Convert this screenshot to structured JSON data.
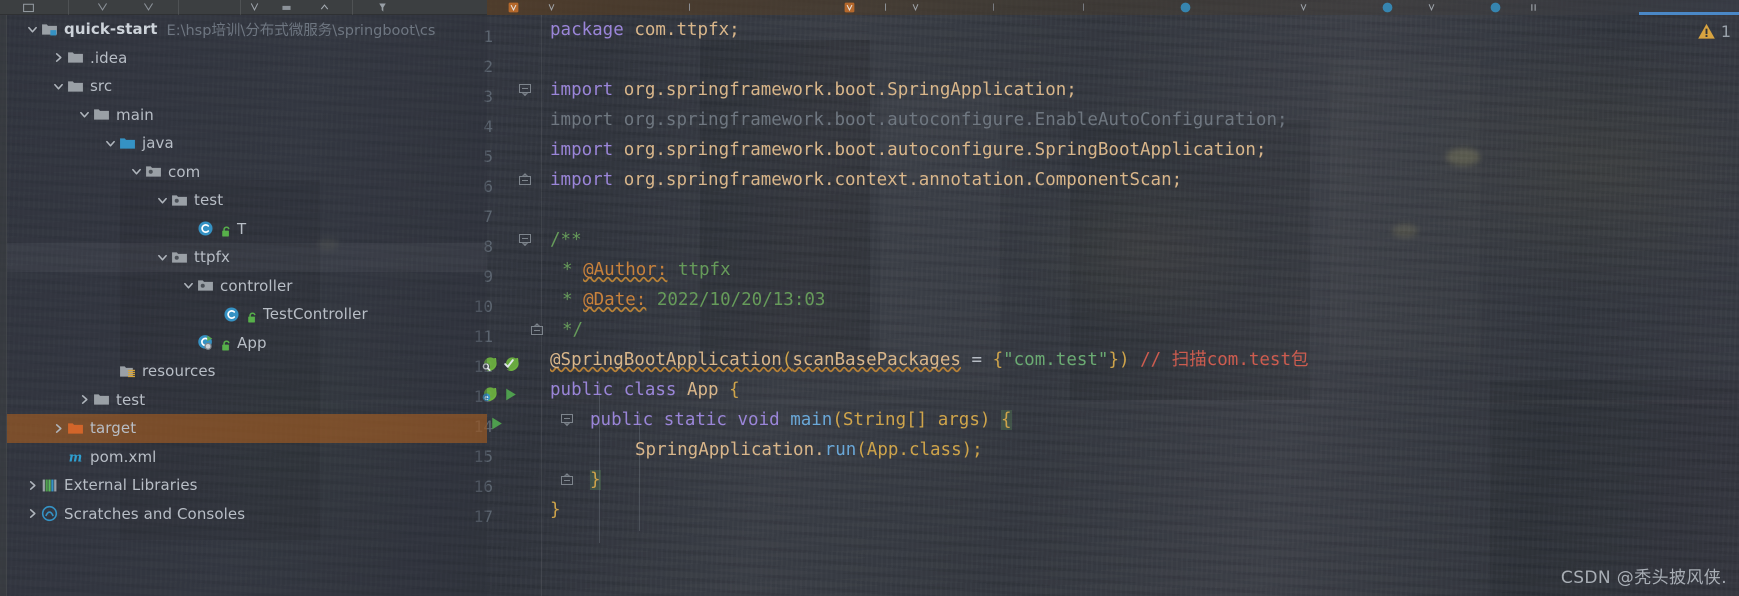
{
  "window": {
    "watermark": "CSDN @秃头披风侠."
  },
  "editor_status": {
    "warning_icon": "warning-triangle-icon",
    "warning_count": "1"
  },
  "project_tree": {
    "root": {
      "label": "quick-start",
      "path": "E:\\hsp培训\\分布式微服务\\springboot\\cs",
      "icon": "module-folder-icon",
      "arrow": "chevron-down-icon"
    },
    "items": [
      {
        "label": ".idea",
        "icon": "folder-icon",
        "arrow": "chevron-right-icon",
        "indent": 1,
        "state": "normal"
      },
      {
        "label": "src",
        "icon": "folder-icon",
        "arrow": "chevron-down-icon",
        "indent": 1,
        "state": "normal"
      },
      {
        "label": "main",
        "icon": "folder-icon",
        "arrow": "chevron-down-icon",
        "indent": 2,
        "state": "normal"
      },
      {
        "label": "java",
        "icon": "source-folder-icon",
        "arrow": "chevron-down-icon",
        "indent": 3,
        "state": "normal"
      },
      {
        "label": "com",
        "icon": "package-folder-icon",
        "arrow": "chevron-down-icon",
        "indent": 4,
        "state": "normal"
      },
      {
        "label": "test",
        "icon": "package-folder-icon",
        "arrow": "chevron-down-icon",
        "indent": 5,
        "state": "normal"
      },
      {
        "label": "T",
        "icon": "java-class-icon",
        "arrow": "none",
        "indent": 6,
        "state": "normal",
        "lock": "unlocked-icon"
      },
      {
        "label": "ttpfx",
        "icon": "package-folder-icon",
        "arrow": "chevron-down-icon",
        "indent": 5,
        "state": "hover"
      },
      {
        "label": "controller",
        "icon": "package-folder-icon",
        "arrow": "chevron-down-icon",
        "indent": 6,
        "state": "normal"
      },
      {
        "label": "TestController",
        "icon": "java-class-icon",
        "arrow": "none",
        "indent": 7,
        "state": "normal",
        "lock": "unlocked-icon"
      },
      {
        "label": "App",
        "icon": "java-class-runnable-icon",
        "arrow": "none",
        "indent": 6,
        "state": "normal",
        "lock": "unlocked-icon"
      },
      {
        "label": "resources",
        "icon": "resources-folder-icon",
        "arrow": "none",
        "indent": 3,
        "state": "normal"
      },
      {
        "label": "test",
        "icon": "folder-icon",
        "arrow": "chevron-right-icon",
        "indent": 2,
        "state": "normal"
      },
      {
        "label": "target",
        "icon": "excluded-folder-icon",
        "arrow": "chevron-right-icon",
        "indent": 1,
        "state": "selected"
      },
      {
        "label": "pom.xml",
        "icon": "maven-pom-icon",
        "arrow": "none",
        "indent": 1,
        "state": "normal"
      },
      {
        "label": "External Libraries",
        "icon": "libraries-icon",
        "arrow": "chevron-right-icon",
        "indent": 0,
        "state": "normal"
      },
      {
        "label": "Scratches and Consoles",
        "icon": "scratches-icon",
        "arrow": "chevron-right-icon",
        "indent": 0,
        "state": "normal"
      }
    ]
  },
  "code": {
    "language": "java",
    "lines": [
      {
        "n": "1",
        "gutter": []
      },
      {
        "n": "2",
        "gutter": []
      },
      {
        "n": "3",
        "gutter": [],
        "fold": "fold-collapse-icon"
      },
      {
        "n": "4",
        "gutter": []
      },
      {
        "n": "5",
        "gutter": []
      },
      {
        "n": "6",
        "gutter": [],
        "fold": "fold-end-icon"
      },
      {
        "n": "7",
        "gutter": []
      },
      {
        "n": "8",
        "gutter": [],
        "fold": "fold-collapse-icon"
      },
      {
        "n": "9",
        "gutter": []
      },
      {
        "n": "10",
        "gutter": []
      },
      {
        "n": "11",
        "gutter": [],
        "fold": "fold-end-icon"
      },
      {
        "n": "12",
        "gutter": [
          "spring-search-bean-icon",
          "spring-checked-bean-icon"
        ]
      },
      {
        "n": "13",
        "gutter": [
          "spring-bean-icon",
          "run-class-icon"
        ]
      },
      {
        "n": "14",
        "gutter": [
          "run-method-icon"
        ],
        "fold": "fold-collapse-icon"
      },
      {
        "n": "15",
        "gutter": []
      },
      {
        "n": "16",
        "gutter": [],
        "fold": "fold-end-icon"
      },
      {
        "n": "17",
        "gutter": []
      }
    ],
    "text": {
      "l1_package_kw": "package",
      "l1_name": "com.ttpfx;",
      "l3_import_kw": "import",
      "l3_name": "org.springframework.boot.SpringApplication;",
      "l4_import_kw": "import",
      "l4_name": "org.springframework.boot.autoconfigure.EnableAutoConfiguration;",
      "l5_import_kw": "import",
      "l5_name": "org.springframework.boot.autoconfigure.SpringBootApplication;",
      "l6_import_kw": "import",
      "l6_name": "org.springframework.context.annotation.ComponentScan;",
      "l8": "/**",
      "l9_star": "*",
      "l9_tag": "@Author:",
      "l9_val": "ttpfx",
      "l10_star": "*",
      "l10_tag": "@Date:",
      "l10_val": "2022/10/20/13:03",
      "l11": "*/",
      "l12_ann": "@SpringBootApplication",
      "l12_open": "(",
      "l12_attr": "scanBasePackages",
      "l12_eq": "=",
      "l12_brace_open": "{",
      "l12_str": "\"com.test\"",
      "l12_brace_close": "}",
      "l12_close": ")",
      "l12_comment": "// 扫描com.test包",
      "l13_mod": "public class",
      "l13_name": "App",
      "l13_brace": "{",
      "l14_mod": "public static void",
      "l14_name": "main",
      "l14_params": "(String[] args)",
      "l14_brace": "{",
      "l15_call": "SpringApplication.",
      "l15_method": "run",
      "l15_args": "(App.class);",
      "l16": "}",
      "l17": "}"
    }
  },
  "colors": {
    "selection_orange": "#a85d21",
    "keyword_purple": "#9a85d8",
    "string_green": "#6bab73",
    "identifier_tan": "#d9b68a",
    "comment_green": "#669b5a",
    "comment_red": "#cd5c4f",
    "javadoc_tag_orange": "#c8813b",
    "accent_blue": "#4a88c7",
    "folder_blue": "#3592c4",
    "warning_yellow": "#d9a440",
    "spring_green": "#6db33f"
  }
}
